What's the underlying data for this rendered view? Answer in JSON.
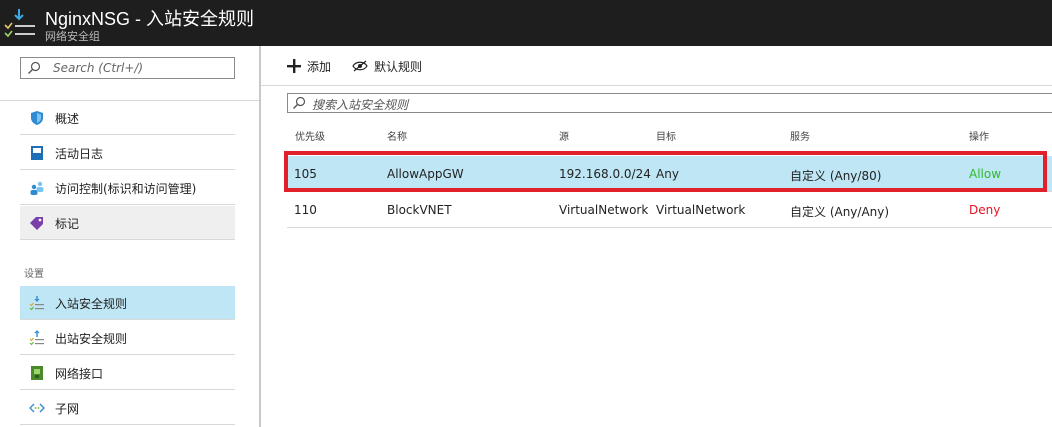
{
  "header": {
    "title": "NginxNSG - 入站安全规则",
    "subtitle": "网络安全组"
  },
  "sidebar": {
    "search_placeholder": "Search (Ctrl+/)",
    "items": [
      {
        "label": "概述",
        "icon": "shield-icon"
      },
      {
        "label": "活动日志",
        "icon": "log-icon"
      },
      {
        "label": "访问控制(标识和访问管理)",
        "icon": "people-icon"
      },
      {
        "label": "标记",
        "icon": "tag-icon"
      }
    ],
    "section_label": "设置",
    "settings_items": [
      {
        "label": "入站安全规则",
        "icon": "inbound-rules-icon"
      },
      {
        "label": "出站安全规则",
        "icon": "outbound-rules-icon"
      },
      {
        "label": "网络接口",
        "icon": "network-interface-icon"
      },
      {
        "label": "子网",
        "icon": "subnet-icon"
      }
    ]
  },
  "toolbar": {
    "add_label": "添加",
    "default_rules_label": "默认规则"
  },
  "filter": {
    "placeholder": "搜索入站安全规则"
  },
  "table": {
    "columns": [
      "优先级",
      "名称",
      "源",
      "目标",
      "服务",
      "操作"
    ],
    "rows": [
      {
        "priority": "105",
        "name": "AllowAppGW",
        "source": "192.168.0.0/24",
        "destination": "Any",
        "service": "自定义 (Any/80)",
        "action": "Allow",
        "action_color": "#2dbb2d",
        "selected": true
      },
      {
        "priority": "110",
        "name": "BlockVNET",
        "source": "VirtualNetwork",
        "destination": "VirtualNetwork",
        "service": "自定义 (Any/Any)",
        "action": "Deny",
        "action_color": "#e81123",
        "selected": false
      }
    ]
  },
  "colors": {
    "selection": "#bfe6f5",
    "highlight_border": "#e0202a",
    "header_bg": "#1e1e1e"
  }
}
